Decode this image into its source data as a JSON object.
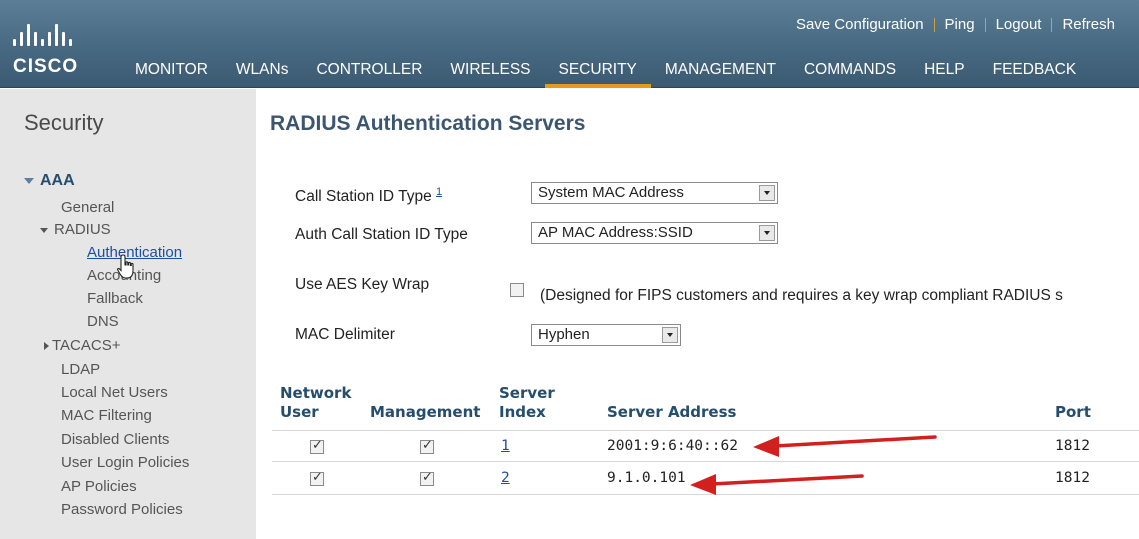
{
  "header": {
    "brand": "CISCO",
    "top_links": [
      "Save Configuration",
      "Ping",
      "Logout",
      "Refresh"
    ],
    "nav": [
      "MONITOR",
      "WLANs",
      "CONTROLLER",
      "WIRELESS",
      "SECURITY",
      "MANAGEMENT",
      "COMMANDS",
      "HELP",
      "FEEDBACK"
    ],
    "active_nav": "SECURITY"
  },
  "sidebar": {
    "title": "Security",
    "aaa": "AAA",
    "general": "General",
    "radius": "RADIUS",
    "radius_items": [
      "Authentication",
      "Accounting",
      "Fallback",
      "DNS"
    ],
    "tacacs": "TACACS+",
    "items": [
      "LDAP",
      "Local Net Users",
      "MAC Filtering",
      "Disabled Clients",
      "User Login Policies",
      "AP Policies",
      "Password Policies"
    ]
  },
  "main": {
    "title": "RADIUS Authentication Servers",
    "call_station_label": "Call Station ID Type",
    "call_station_footnote": "1",
    "call_station_value": "System MAC Address",
    "auth_call_station_label": "Auth Call Station ID Type",
    "auth_call_station_value": "AP MAC Address:SSID",
    "aes_label": "Use AES Key Wrap",
    "aes_checked": false,
    "aes_note": "(Designed for FIPS customers and requires a key wrap compliant RADIUS s",
    "mac_delimiter_label": "MAC Delimiter",
    "mac_delimiter_value": "Hyphen"
  },
  "table": {
    "headers": {
      "network_user_1": "Network",
      "network_user_2": "User",
      "management": "Management",
      "server_index_1": "Server",
      "server_index_2": "Index",
      "server_address": "Server Address",
      "port": "Port"
    },
    "rows": [
      {
        "network_user": true,
        "management": true,
        "index": "1",
        "address": "2001:9:6:40::62",
        "port": "1812"
      },
      {
        "network_user": true,
        "management": true,
        "index": "2",
        "address": "9.1.0.101",
        "port": "1812"
      }
    ]
  },
  "colors": {
    "header": "#4a6c85",
    "active_tab": "#e59a1f",
    "arrow": "#d41f1f"
  },
  "icons": [
    "cisco-logo-icon",
    "hand-cursor-icon",
    "annotation-arrow-icon"
  ]
}
